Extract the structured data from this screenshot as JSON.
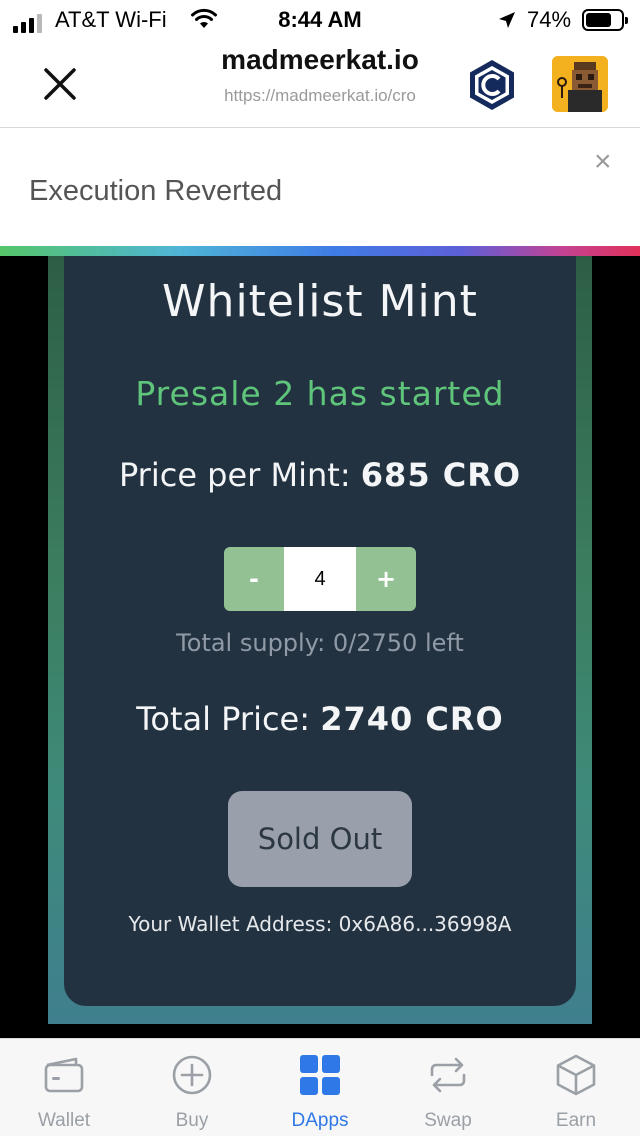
{
  "status_bar": {
    "carrier": "AT&T Wi-Fi",
    "time": "8:44 AM",
    "battery": "74%",
    "battery_level": 0.74
  },
  "browser": {
    "site_title": "madmeerkat.io",
    "url": "https://madmeerkat.io/cro"
  },
  "toast": {
    "message": "Execution Reverted",
    "close_label": "×"
  },
  "mint": {
    "title": "Whitelist Mint",
    "presale_status": "Presale 2 has started",
    "price_label": "Price per Mint:",
    "price_value": "685 CRO",
    "decrement_label": "-",
    "quantity": "4",
    "increment_label": "+",
    "supply": "Total supply: 0/2750 left",
    "total_label": "Total Price:",
    "total_value": "2740 CRO",
    "action_button": "Sold Out",
    "wallet_address": "Your Wallet Address: 0x6A86...36998A"
  },
  "tab_bar": {
    "tabs": [
      {
        "label": "Wallet",
        "icon": "wallet-icon"
      },
      {
        "label": "Buy",
        "icon": "plus-circle-icon"
      },
      {
        "label": "DApps",
        "icon": "grid-icon"
      },
      {
        "label": "Swap",
        "icon": "swap-icon"
      },
      {
        "label": "Earn",
        "icon": "cube-icon"
      }
    ],
    "active": "DApps"
  },
  "colors": {
    "accent": "#2f78e8",
    "presale_green": "#5fc57a",
    "stepper_green": "#93c194",
    "card_bg": "#233241"
  }
}
